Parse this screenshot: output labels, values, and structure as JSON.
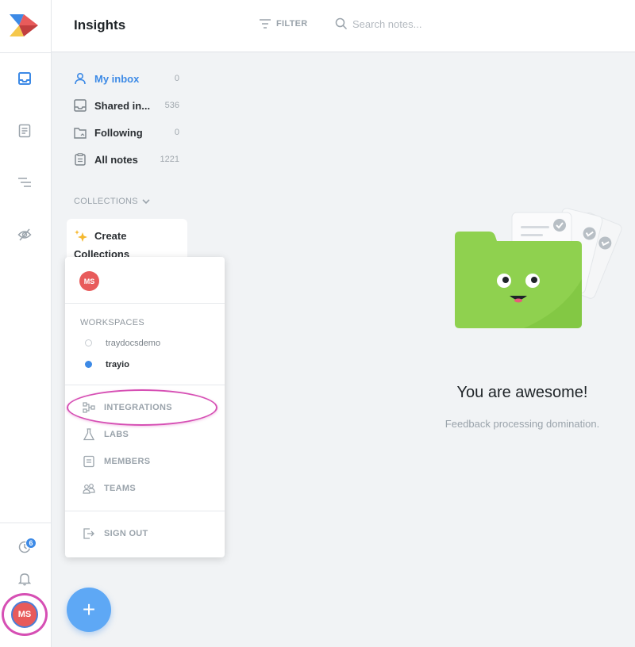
{
  "header": {
    "title": "Insights",
    "filter_label": "FILTER",
    "search_placeholder": "Search notes..."
  },
  "rail": {
    "icons": [
      "inbox-icon",
      "notes-icon",
      "roadmap-icon",
      "hidden-icon"
    ],
    "activity_badge": "6",
    "avatar_initials": "MS"
  },
  "nav": {
    "items": [
      {
        "label": "My inbox",
        "count": "0",
        "icon": "user-icon"
      },
      {
        "label": "Shared in...",
        "count": "536",
        "icon": "inbox-icon"
      },
      {
        "label": "Following",
        "count": "0",
        "icon": "folder-icon"
      },
      {
        "label": "All notes",
        "count": "1221",
        "icon": "clipboard-icon"
      }
    ],
    "collections_label": "COLLECTIONS",
    "create_label_line1": "Create",
    "create_label_line2": "Collections"
  },
  "dropdown": {
    "avatar_initials": "MS",
    "workspaces_label": "WORKSPACES",
    "workspaces": [
      {
        "name": "traydocsdemo",
        "active": false
      },
      {
        "name": "trayio",
        "active": true
      }
    ],
    "menu": [
      {
        "label": "INTEGRATIONS",
        "icon": "integrations-icon"
      },
      {
        "label": "LABS",
        "icon": "flask-icon"
      },
      {
        "label": "MEMBERS",
        "icon": "members-icon"
      },
      {
        "label": "TEAMS",
        "icon": "teams-icon"
      }
    ],
    "sign_out_label": "SIGN OUT"
  },
  "fab": {
    "label": "+"
  },
  "empty_state": {
    "title": "You are awesome!",
    "subtitle": "Feedback processing domination."
  },
  "colors": {
    "accent": "#3d8ae6",
    "avatar": "#e85b5b",
    "highlight": "#d64fb4",
    "fab": "#5ea8f5",
    "folder": "#8fd14f"
  }
}
